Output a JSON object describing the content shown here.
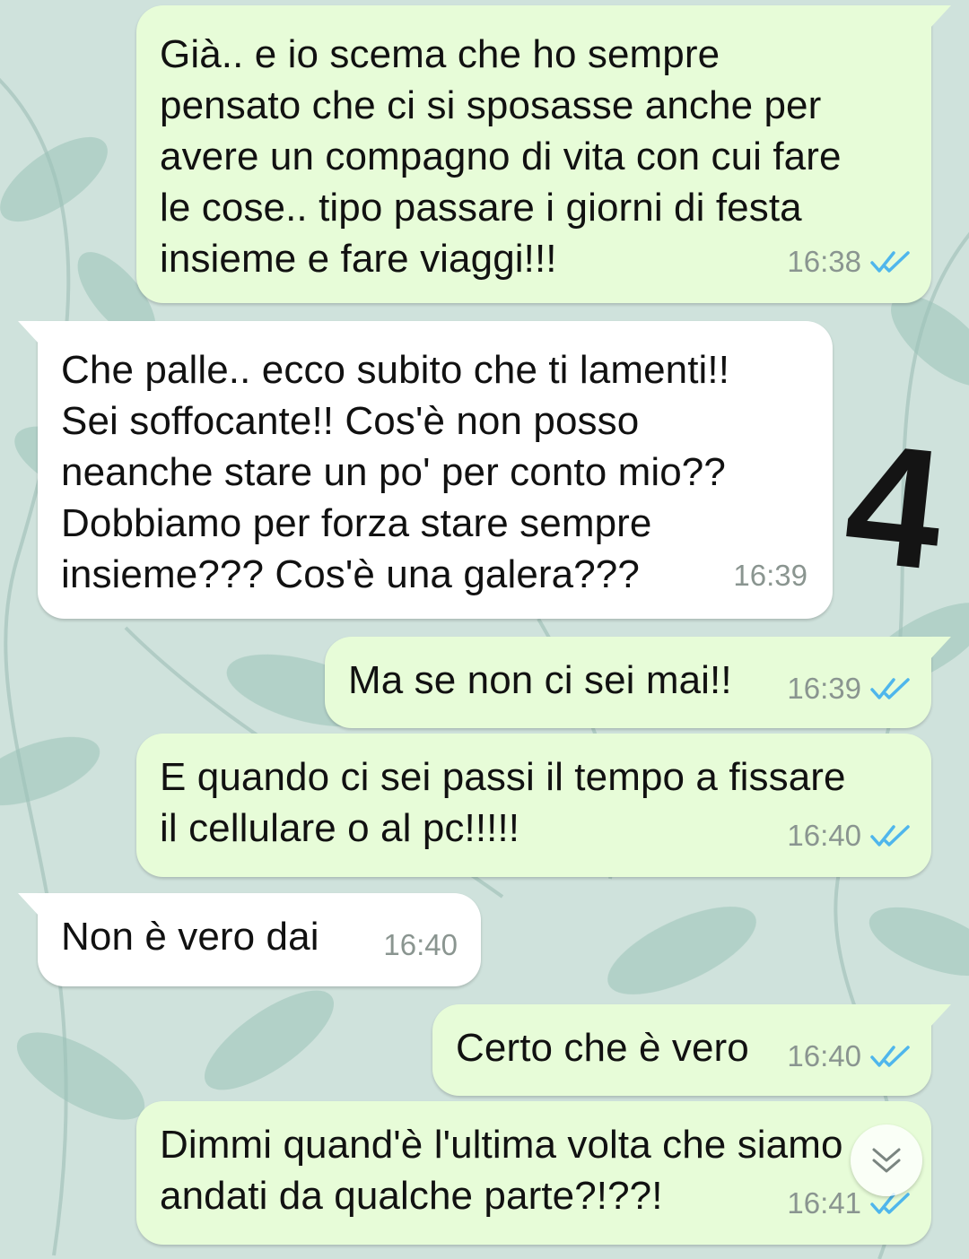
{
  "messages": [
    {
      "direction": "outgoing",
      "text": "Già.. e io scema che ho sempre\npensato che ci si sposasse anche per\navere un compagno di vita con cui fare\nle cose.. tipo passare i giorni di festa\ninsieme e fare viaggi!!!",
      "time": "16:38",
      "status": "read"
    },
    {
      "direction": "incoming",
      "text": "Che palle.. ecco subito che ti lamenti!!\nSei soffocante!! Cos'è non posso\nneanche stare un po' per conto mio??\nDobbiamo per forza stare sempre\ninsieme??? Cos'è una galera???",
      "time": "16:39"
    },
    {
      "direction": "outgoing",
      "text": "Ma se non ci sei mai!!",
      "time": "16:39",
      "status": "read"
    },
    {
      "direction": "outgoing",
      "text": "E quando ci sei passi il tempo a fissare\nil cellulare o al pc!!!!!",
      "time": "16:40",
      "status": "read"
    },
    {
      "direction": "incoming",
      "text": "Non è vero dai",
      "time": "16:40"
    },
    {
      "direction": "outgoing",
      "text": "Certo che è vero",
      "time": "16:40",
      "status": "read"
    },
    {
      "direction": "outgoing",
      "text": "Dimmi quand'è l'ultima volta che siamo\nandati da qualche parte?!??!",
      "time": "16:41",
      "status": "read"
    }
  ],
  "overlay": {
    "drawn_number": "4"
  },
  "icons": {
    "read_receipt": "double-check-icon",
    "scroll_down": "chevron-down-icon"
  },
  "colors": {
    "outgoing_bubble": "#e7fcd8",
    "incoming_bubble": "#ffffff",
    "read_tick": "#4fb6ec",
    "timestamp": "#8a9590",
    "wallpaper": "#cfe2dc"
  }
}
